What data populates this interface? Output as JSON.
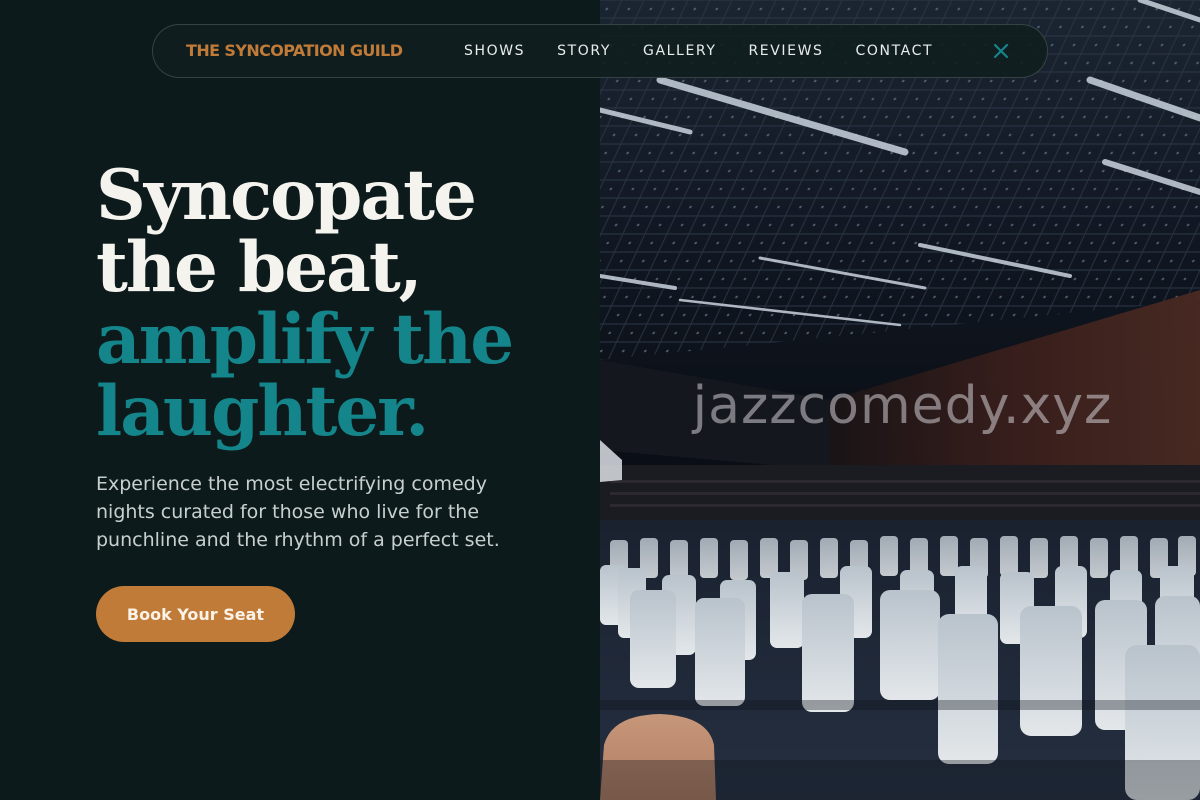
{
  "brand": {
    "name": "THE SYNCOPATION GUILD"
  },
  "nav": {
    "links": [
      {
        "label": "SHOWS"
      },
      {
        "label": "STORY"
      },
      {
        "label": "GALLERY"
      },
      {
        "label": "REVIEWS"
      },
      {
        "label": "CONTACT"
      }
    ],
    "close_icon": "close-icon"
  },
  "hero": {
    "headline_lines": [
      "Syncopate",
      "the beat,",
      "amplify the",
      "laughter."
    ],
    "subtext": "Experience the most electrifying comedy nights curated for those who live for the punchline and the rhythm of a perfect set.",
    "cta_label": "Book Your Seat"
  },
  "image": {
    "watermark": "jazzcomedy.xyz"
  },
  "colors": {
    "background": "#0d1a1b",
    "accent_orange": "#c17b38",
    "accent_teal": "#14858a",
    "headline_white": "#f4f3ee",
    "body_text": "#c8cfcf"
  }
}
